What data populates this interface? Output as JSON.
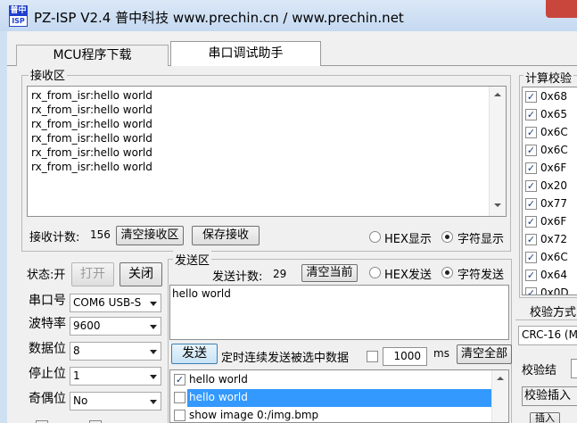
{
  "window": {
    "title": "PZ-ISP V2.4 普中科技 www.prechin.cn / www.prechin.net",
    "icon_top": "普中",
    "icon_bottom": "ISP"
  },
  "tabs": [
    {
      "label": "MCU程序下载",
      "active": false
    },
    {
      "label": "串口调试助手",
      "active": true
    }
  ],
  "receive": {
    "group_label": "接收区",
    "lines": [
      "rx_from_isr:hello world",
      "rx_from_isr:hello world",
      "rx_from_isr:hello world",
      "rx_from_isr:hello world",
      "rx_from_isr:hello world",
      "rx_from_isr:hello world"
    ],
    "count_label": "接收计数:",
    "count_value": "156",
    "clear_button": "清空接收区",
    "save_button": "保存接收",
    "hex_display_label": "HEX显示",
    "char_display_label": "字符显示",
    "display_mode": "char"
  },
  "port": {
    "status_label": "状态:开",
    "open_button": "打开",
    "close_button": "关闭",
    "port_label": "串口号",
    "port_value": "COM6  USB-S",
    "baud_label": "波特率",
    "baud_value": "9600",
    "databits_label": "数据位",
    "databits_value": "8",
    "stopbits_label": "停止位",
    "stopbits_value": "1",
    "parity_label": "奇偶位",
    "parity_value": "No"
  },
  "send": {
    "group_label": "发送区",
    "count_label": "发送计数:",
    "count_value": "29",
    "clear_button": "清空当前",
    "hex_send_label": "HEX发送",
    "char_send_label": "字符发送",
    "send_mode": "char",
    "text": "hello world",
    "send_button": "发送",
    "timed_label": "定时连续发送被选中数据",
    "interval_value": "1000",
    "interval_unit": "ms",
    "clear_all_button": "清空全部",
    "items": [
      {
        "text": "hello world",
        "checked": true,
        "selected": false
      },
      {
        "text": "hello world",
        "checked": false,
        "selected": true
      },
      {
        "text": "show image 0:/img.bmp",
        "checked": false,
        "selected": false
      }
    ]
  },
  "checksum": {
    "group_label": "计算校验",
    "bytes": [
      "0x68",
      "0x65",
      "0x6C",
      "0x6C",
      "0x6F",
      "0x20",
      "0x77",
      "0x6F",
      "0x72",
      "0x6C",
      "0x64",
      "0x0D"
    ],
    "method_label": "校验方式",
    "method_value": "CRC-16 (Mo",
    "result_label": "校验结",
    "insert_label": "校验插入",
    "insert_button": "插入"
  },
  "colors": {
    "accent": "#3399ff",
    "titlebar": "#c5d9f1",
    "close": "#c9463d"
  }
}
